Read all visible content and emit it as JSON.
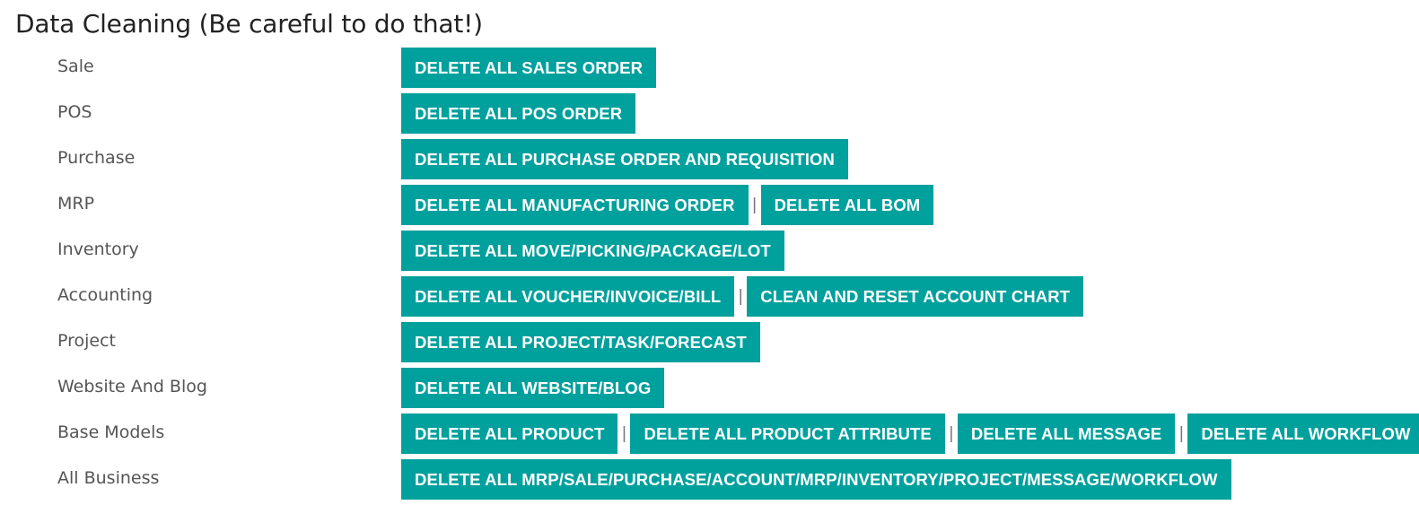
{
  "title": "Data Cleaning (Be careful to do that!)",
  "separator": "|",
  "colors": {
    "button_bg": "#00a09d",
    "button_text": "#ffffff",
    "label_text": "#555555",
    "title_text": "#222222"
  },
  "rows": [
    {
      "label": "Sale",
      "buttons": [
        "DELETE ALL SALES ORDER"
      ]
    },
    {
      "label": "POS",
      "buttons": [
        "DELETE ALL POS ORDER"
      ]
    },
    {
      "label": "Purchase",
      "buttons": [
        "DELETE ALL PURCHASE ORDER AND REQUISITION"
      ]
    },
    {
      "label": "MRP",
      "buttons": [
        "DELETE ALL MANUFACTURING ORDER",
        "DELETE ALL BOM"
      ]
    },
    {
      "label": "Inventory",
      "buttons": [
        "DELETE ALL MOVE/PICKING/PACKAGE/LOT"
      ]
    },
    {
      "label": "Accounting",
      "buttons": [
        "DELETE ALL VOUCHER/INVOICE/BILL",
        "CLEAN AND RESET ACCOUNT CHART"
      ]
    },
    {
      "label": "Project",
      "buttons": [
        "DELETE ALL PROJECT/TASK/FORECAST"
      ]
    },
    {
      "label": "Website And Blog",
      "buttons": [
        "DELETE ALL WEBSITE/BLOG"
      ]
    },
    {
      "label": "Base Models",
      "buttons": [
        "DELETE ALL PRODUCT",
        "DELETE ALL PRODUCT ATTRIBUTE",
        "DELETE ALL MESSAGE",
        "DELETE ALL WORKFLOW"
      ]
    },
    {
      "label": "All Business",
      "buttons": [
        "DELETE ALL MRP/SALE/PURCHASE/ACCOUNT/MRP/INVENTORY/PROJECT/MESSAGE/WORKFLOW"
      ]
    }
  ]
}
